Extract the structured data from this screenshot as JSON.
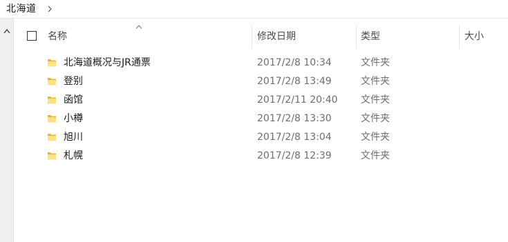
{
  "breadcrumb": {
    "location": "北海道",
    "chevron_icon": "chevron-right-icon"
  },
  "columns": {
    "name": "名称",
    "date_modified": "修改日期",
    "type": "类型",
    "size": "大小",
    "sort_indicator": "sort-ascending-caret-icon"
  },
  "items": [
    {
      "name": "北海道概况与JR通票",
      "date": "2017/2/8 10:34",
      "type": "文件夹"
    },
    {
      "name": "登别",
      "date": "2017/2/8 13:49",
      "type": "文件夹"
    },
    {
      "name": "函馆",
      "date": "2017/2/11 20:40",
      "type": "文件夹"
    },
    {
      "name": "小樽",
      "date": "2017/2/8 13:30",
      "type": "文件夹"
    },
    {
      "name": "旭川",
      "date": "2017/2/8 13:04",
      "type": "文件夹"
    },
    {
      "name": "札幌",
      "date": "2017/2/8 12:39",
      "type": "文件夹"
    }
  ],
  "colors": {
    "folder_light": "#ffe083",
    "folder_dark": "#e8b432",
    "header_text": "#4a4a4a",
    "secondary_text": "#6d6d6d"
  }
}
